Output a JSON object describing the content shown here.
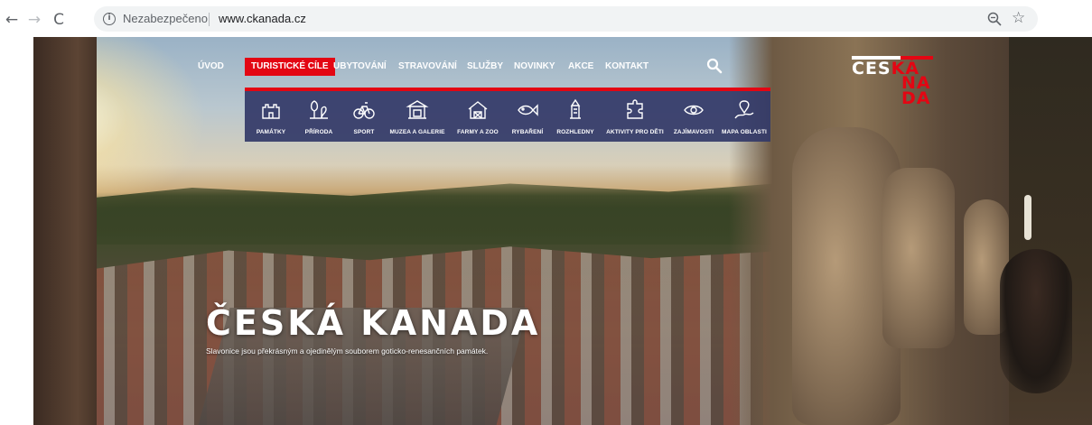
{
  "browser": {
    "back_icon": "←",
    "forward_icon": "→",
    "reload_icon": "C",
    "security_label": "Nezabezpečeno",
    "url": "www.ckanada.cz",
    "bookmark_icon": "☆"
  },
  "site": {
    "logo": {
      "line1_white": "CES",
      "line1_red": "KÁ",
      "stack": [
        "NA",
        "DA"
      ]
    },
    "nav": [
      {
        "label": "ÚVOD"
      },
      {
        "label": "TURISTICKÉ CÍLE",
        "active": true
      },
      {
        "label": "UBYTOVÁNÍ"
      },
      {
        "label": "STRAVOVÁNÍ"
      },
      {
        "label": "SLUŽBY"
      },
      {
        "label": "NOVINKY"
      },
      {
        "label": "AKCE"
      },
      {
        "label": "KONTAKT"
      }
    ],
    "submenu": [
      {
        "label": "PAMÁTKY",
        "icon": "castle-icon"
      },
      {
        "label": "PŘÍRODA",
        "icon": "nature-icon"
      },
      {
        "label": "SPORT",
        "icon": "bike-icon"
      },
      {
        "label": "MUZEA A GALERIE",
        "icon": "museum-icon"
      },
      {
        "label": "FARMY A ZOO",
        "icon": "farm-icon"
      },
      {
        "label": "RYBAŘENÍ",
        "icon": "fish-icon"
      },
      {
        "label": "ROZHLEDNY",
        "icon": "lookout-tower-icon"
      },
      {
        "label": "AKTIVITY PRO DĚTI",
        "icon": "puzzle-icon"
      },
      {
        "label": "ZAJÍMAVOSTI",
        "icon": "eye-icon"
      },
      {
        "label": "MAPA OBLASTI",
        "icon": "map-icon"
      }
    ],
    "hero": {
      "title": "ČESKÁ KANADA",
      "subtitle": "Slavonice jsou překrásným a ojedinělým souborem goticko-renesančních památek."
    },
    "colors": {
      "accent": "#e30613",
      "submenu_bg": "#343a68"
    }
  }
}
